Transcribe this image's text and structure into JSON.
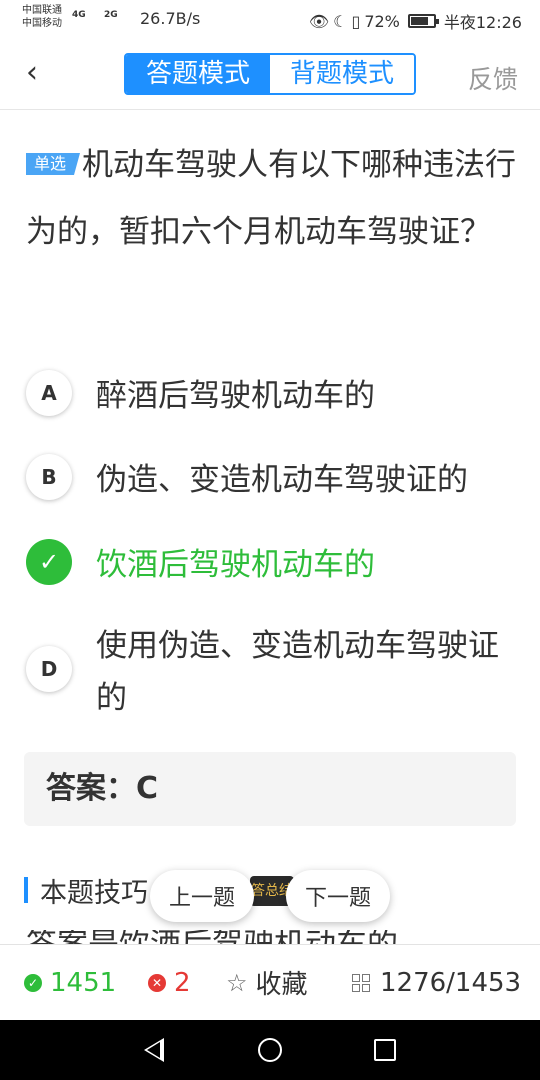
{
  "status_bar": {
    "carrier1": "中国联通",
    "carrier2": "中国移动",
    "signal1": "4G",
    "signal2": "2G",
    "net_speed": "26.7B/s",
    "battery": "72%",
    "time": "半夜12:26"
  },
  "header": {
    "mode_answer": "答题模式",
    "mode_memorize": "背题模式",
    "feedback": "反馈"
  },
  "question": {
    "type_tag": "单选",
    "text": "机动车驾驶人有以下哪种违法行为的，暂扣六个月机动车驾驶证？"
  },
  "options": [
    {
      "letter": "A",
      "text": "醉酒后驾驶机动车的",
      "state": "normal"
    },
    {
      "letter": "B",
      "text": "伪造、变造机动车驾驶证的",
      "state": "normal"
    },
    {
      "letter": "C",
      "text": "饮酒后驾驶机动车的",
      "state": "correct"
    },
    {
      "letter": "D",
      "text": "使用伪造、变造机动车驾驶证的",
      "state": "normal"
    }
  ],
  "answer": {
    "text": "答案：C"
  },
  "tips": {
    "label": "本题技巧",
    "peek_text": "答总结",
    "partial_text": "答案是饮酒后驾驶机动车的"
  },
  "float_buttons": {
    "prev": "上一题",
    "next": "下一题"
  },
  "bottom_bar": {
    "right_count": "1451",
    "wrong_count": "2",
    "favorite": "收藏",
    "progress": "1276/1453"
  },
  "colors": {
    "primary": "#1e90ff",
    "correct": "#2ebd3a",
    "wrong": "#e53935",
    "answer_bg": "#f4f4f4"
  }
}
